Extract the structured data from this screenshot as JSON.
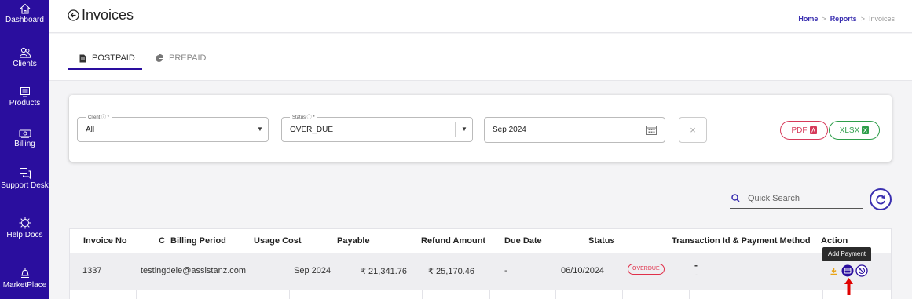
{
  "sidebar": {
    "items": [
      {
        "label": "Dashboard",
        "icon": "home-icon"
      },
      {
        "label": "Clients",
        "icon": "clients-icon"
      },
      {
        "label": "Products",
        "icon": "products-icon"
      },
      {
        "label": "Billing",
        "icon": "billing-icon"
      },
      {
        "label": "Support Desk",
        "icon": "support-icon"
      },
      {
        "label": "Help Docs",
        "icon": "help-icon"
      },
      {
        "label": "MarketPlace",
        "icon": "marketplace-icon"
      }
    ]
  },
  "header": {
    "title": "Invoices",
    "breadcrumb": {
      "home": "Home",
      "reports": "Reports",
      "current": "Invoices"
    }
  },
  "tabs": [
    {
      "label": "POSTPAID",
      "active": true
    },
    {
      "label": "PREPAID",
      "active": false
    }
  ],
  "filters": {
    "client": {
      "legend": "Client ⓘ *",
      "value": "All"
    },
    "status": {
      "legend": "Status ⓘ *",
      "value": "OVER_DUE"
    },
    "date": {
      "value": "Sep 2024"
    },
    "clear_label": "×",
    "pdf_label": "PDF",
    "xlsx_label": "XLSX"
  },
  "search": {
    "placeholder": "Quick Search"
  },
  "table": {
    "headers": {
      "invoice_no": "Invoice No",
      "c": "C",
      "billing_period": "Billing Period",
      "usage_cost": "Usage Cost",
      "payable": "Payable",
      "refund_amount": "Refund Amount",
      "due_date": "Due Date",
      "status": "Status",
      "transaction": "Transaction Id & Payment Method",
      "action": "Action"
    },
    "rows": [
      {
        "invoice_no": "1337",
        "client": "testingdele@assistanz.com",
        "billing_period": "Sep 2024",
        "payable": "₹ 21,341.76",
        "refund_amount": "₹ 25,170.46",
        "dash": "-",
        "due_date": "06/10/2024",
        "status": "OVERDUE",
        "transaction_top": "-",
        "transaction_bottom": "-"
      }
    ]
  },
  "tooltip": "Add Payment",
  "colors": {
    "brand": "#2a0e9e",
    "overdue": "#e0304a",
    "pdf": "#d63a5a",
    "xlsx": "#2e9e4a"
  }
}
